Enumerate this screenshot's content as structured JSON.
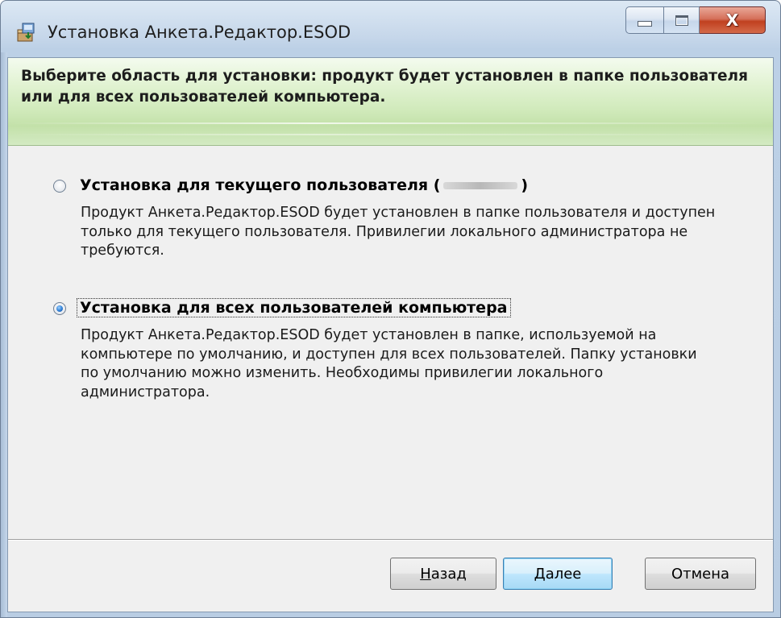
{
  "window": {
    "title": "Установка Анкета.Редактор.ESOD",
    "close_glyph": "X"
  },
  "banner": {
    "text": "Выберите область для установки: продукт будет установлен в папке пользователя или для всех пользователей компьютера."
  },
  "options": [
    {
      "label_prefix": "Установка для текущего пользователя (",
      "label_suffix": ")",
      "description": "Продукт Анкета.Редактор.ESOD будет установлен в папке пользователя и доступен только для текущего пользователя. Привилегии локального администратора не требуются.",
      "selected": false
    },
    {
      "label": "Установка для всех пользователей компьютера",
      "description": "Продукт Анкета.Редактор.ESOD будет установлен в папке, используемой на компьютере по умолчанию, и доступен для всех пользователей. Папку установки по умолчанию можно изменить. Необходимы привилегии локального администратора.",
      "selected": true
    }
  ],
  "buttons": {
    "back": {
      "mnemonic": "Н",
      "rest": "азад"
    },
    "next": {
      "mnemonic": "Д",
      "rest": "алее"
    },
    "cancel": "Отмена"
  },
  "colors": {
    "accent": "#3c7fb1",
    "banner_green": "#cfe9b9",
    "close_red": "#c0401f"
  }
}
